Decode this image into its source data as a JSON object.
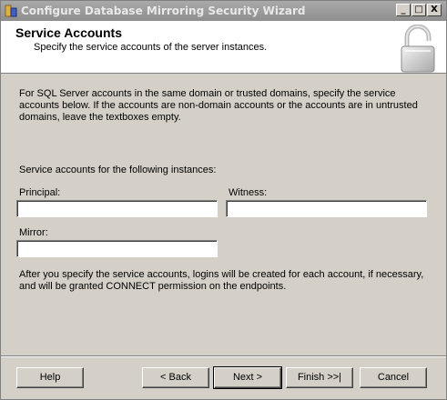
{
  "window": {
    "title": "Configure Database Mirroring Security Wizard",
    "caption_buttons": {
      "minimize": "_",
      "maximize": "□",
      "close": "X"
    }
  },
  "header": {
    "title": "Service Accounts",
    "subtitle": "Specify the service accounts of the server instances.",
    "icon": "padlock-icon"
  },
  "intro_text": "For SQL Server accounts in the same domain or trusted domains, specify the service accounts below. If the accounts are non-domain accounts or the accounts are in untrusted domains, leave the textboxes empty.",
  "instances_label": "Service accounts for the following instances:",
  "fields": {
    "principal": {
      "label": "Principal:",
      "value": ""
    },
    "witness": {
      "label": "Witness:",
      "value": ""
    },
    "mirror": {
      "label": "Mirror:",
      "value": ""
    }
  },
  "note_text": "After you specify the service accounts, logins will be created for each account, if necessary, and will be granted CONNECT permission on the endpoints.",
  "buttons": {
    "help": "Help",
    "back": "< Back",
    "next": "Next >",
    "finish": "Finish >>|",
    "cancel": "Cancel"
  }
}
